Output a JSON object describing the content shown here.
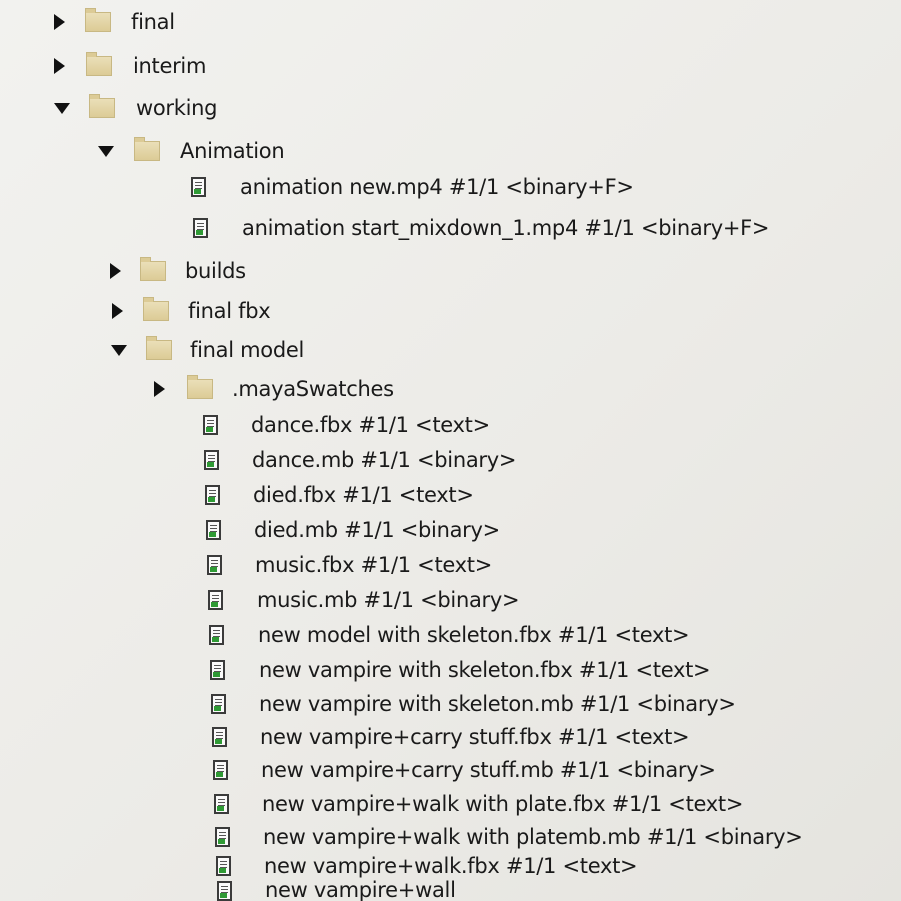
{
  "tree": {
    "final": "final",
    "interim": "interim",
    "working": "working",
    "animation": "Animation",
    "animation_new": "animation new.mp4 #1/1 <binary+F>",
    "animation_start": "animation start_mixdown_1.mp4 #1/1 <binary+F>",
    "builds": "builds",
    "final_fbx": "final fbx",
    "final_model": "final model",
    "maya_swatches": ".mayaSwatches",
    "files": [
      "dance.fbx #1/1 <text>",
      "dance.mb #1/1 <binary>",
      "died.fbx #1/1 <text>",
      "died.mb #1/1 <binary>",
      "music.fbx #1/1 <text>",
      "music.mb #1/1 <binary>",
      "new model with skeleton.fbx #1/1 <text>",
      "new vampire with skeleton.fbx #1/1 <text>",
      "new vampire with skeleton.mb #1/1 <binary>",
      "new vampire+carry stuff.fbx #1/1 <text>",
      "new vampire+carry stuff.mb #1/1 <binary>",
      "new vampire+walk with plate.fbx #1/1 <text>",
      "new vampire+walk with platemb.mb #1/1 <binary>",
      "new vampire+walk.fbx #1/1 <text>",
      "new vampire+wall"
    ]
  }
}
